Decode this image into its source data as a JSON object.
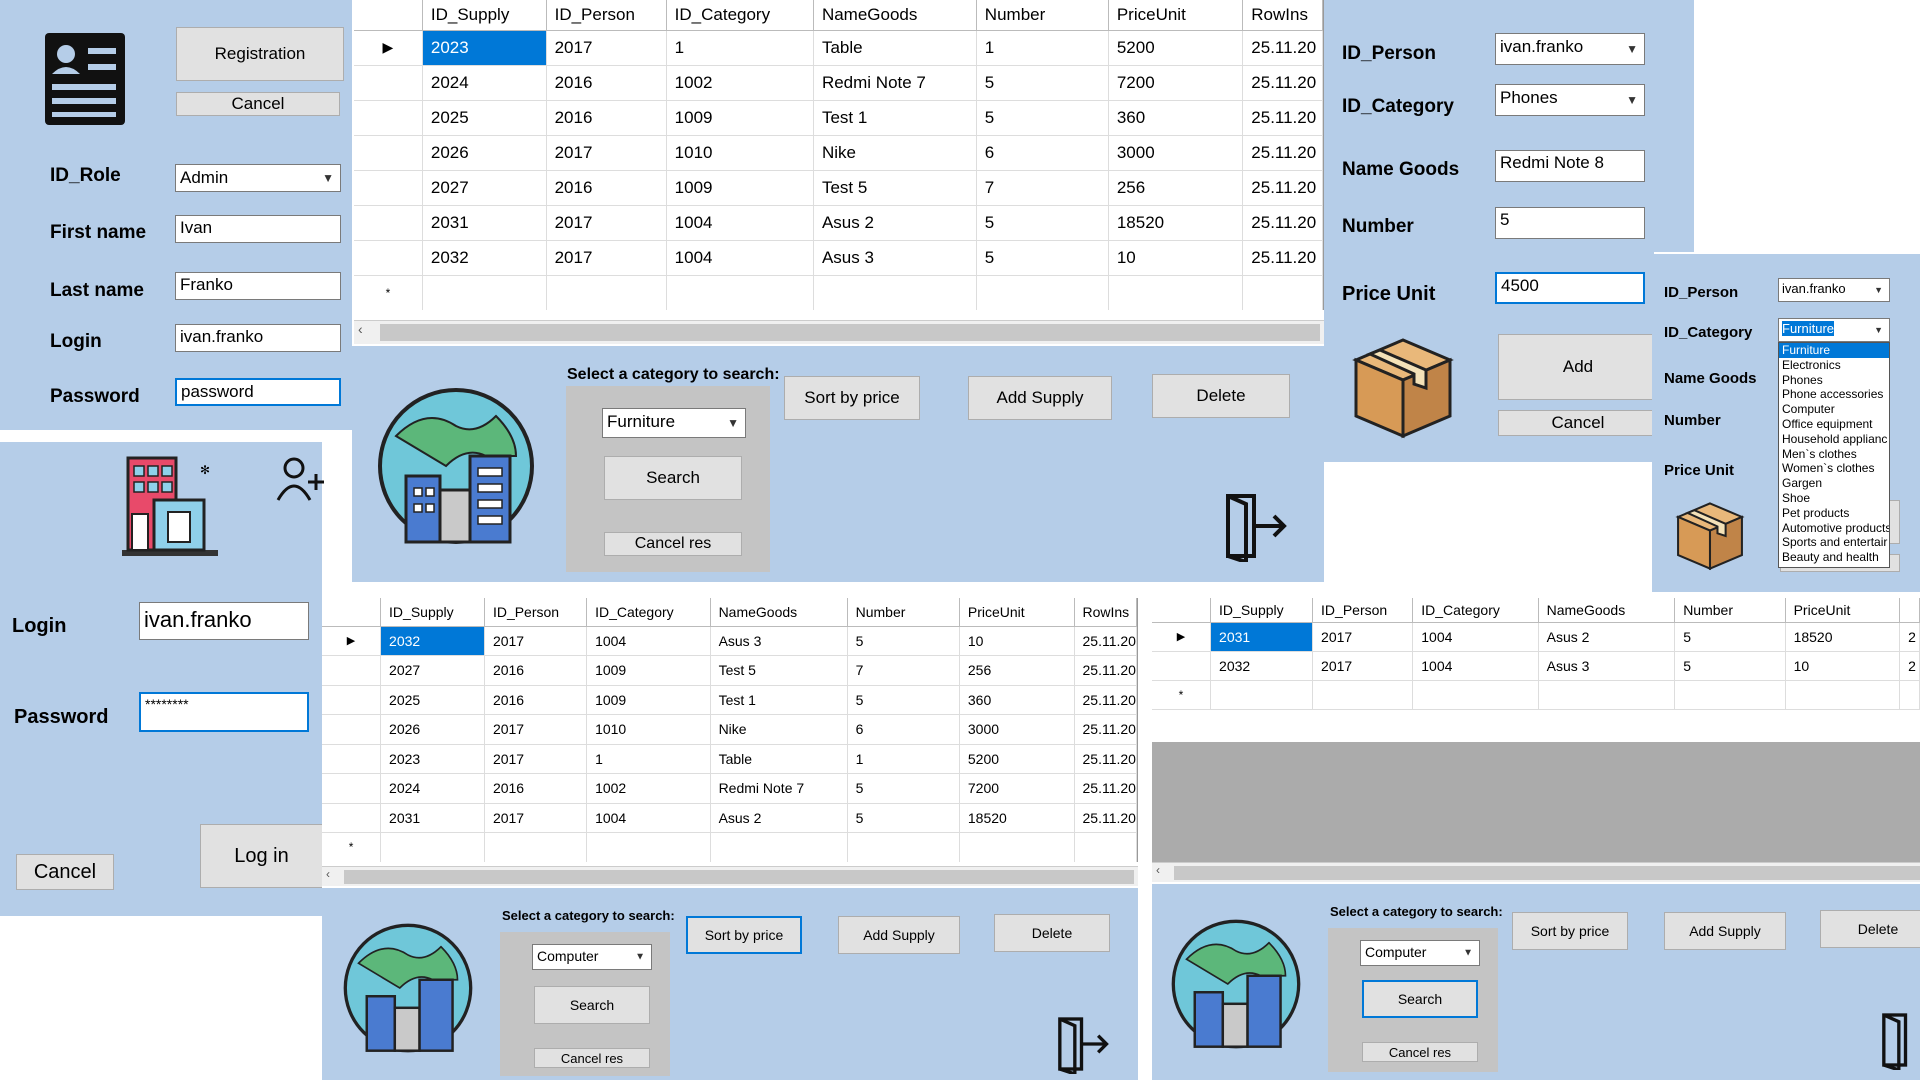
{
  "registration": {
    "btn_registration": "Registration",
    "btn_cancel": "Cancel",
    "lbl_id_role": "ID_Role",
    "val_id_role": "Admin",
    "lbl_first_name": "First name",
    "val_first_name": "Ivan",
    "lbl_last_name": "Last name",
    "val_last_name": "Franko",
    "lbl_login": "Login",
    "val_login": "ivan.franko",
    "lbl_password": "Password",
    "val_password": "password"
  },
  "login": {
    "lbl_login": "Login",
    "val_login": "ivan.franko",
    "lbl_password": "Password",
    "val_password": "********",
    "btn_cancel": "Cancel",
    "btn_login": "Log in"
  },
  "columns": [
    "ID_Supply",
    "ID_Person",
    "ID_Category",
    "NameGoods",
    "Number",
    "PriceUnit",
    "RowIns"
  ],
  "supply_main": {
    "rows": [
      [
        "2023",
        "2017",
        "1",
        "Table",
        "1",
        "5200",
        "25.11.20"
      ],
      [
        "2024",
        "2016",
        "1002",
        "Redmi Note 7",
        "5",
        "7200",
        "25.11.20"
      ],
      [
        "2025",
        "2016",
        "1009",
        "Test 1",
        "5",
        "360",
        "25.11.20"
      ],
      [
        "2026",
        "2017",
        "1010",
        "Nike",
        "6",
        "3000",
        "25.11.20"
      ],
      [
        "2027",
        "2016",
        "1009",
        "Test 5",
        "7",
        "256",
        "25.11.20"
      ],
      [
        "2031",
        "2017",
        "1004",
        "Asus 2",
        "5",
        "18520",
        "25.11.20"
      ],
      [
        "2032",
        "2017",
        "1004",
        "Asus 3",
        "5",
        "10",
        "25.11.20"
      ]
    ],
    "search_label": "Select a category to search:",
    "category": "Furniture",
    "btn_search": "Search",
    "btn_cancel_res": "Cancel res",
    "btn_sort": "Sort by price",
    "btn_add": "Add Supply",
    "btn_delete": "Delete"
  },
  "supply_sorted": {
    "rows": [
      [
        "2032",
        "2017",
        "1004",
        "Asus 3",
        "5",
        "10",
        "25.11.20"
      ],
      [
        "2027",
        "2016",
        "1009",
        "Test 5",
        "7",
        "256",
        "25.11.20"
      ],
      [
        "2025",
        "2016",
        "1009",
        "Test 1",
        "5",
        "360",
        "25.11.20"
      ],
      [
        "2026",
        "2017",
        "1010",
        "Nike",
        "6",
        "3000",
        "25.11.20"
      ],
      [
        "2023",
        "2017",
        "1",
        "Table",
        "1",
        "5200",
        "25.11.20"
      ],
      [
        "2024",
        "2016",
        "1002",
        "Redmi Note 7",
        "5",
        "7200",
        "25.11.20"
      ],
      [
        "2031",
        "2017",
        "1004",
        "Asus 2",
        "5",
        "18520",
        "25.11.20"
      ]
    ],
    "search_label": "Select a category to search:",
    "category": "Computer",
    "btn_search": "Search",
    "btn_cancel_res": "Cancel res",
    "btn_sort": "Sort by price",
    "btn_add": "Add Supply",
    "btn_delete": "Delete"
  },
  "supply_filtered": {
    "rows": [
      [
        "2031",
        "2017",
        "1004",
        "Asus 2",
        "5",
        "18520",
        "2"
      ],
      [
        "2032",
        "2017",
        "1004",
        "Asus 3",
        "5",
        "10",
        "2"
      ]
    ],
    "search_label": "Select a category to search:",
    "category": "Computer",
    "btn_search": "Search",
    "btn_cancel_res": "Cancel res",
    "btn_sort": "Sort by price",
    "btn_add": "Add Supply",
    "btn_delete": "Delete"
  },
  "add_supply": {
    "lbl_id_person": "ID_Person",
    "val_id_person": "ivan.franko",
    "lbl_id_category": "ID_Category",
    "val_id_category": "Phones",
    "lbl_name_goods": "Name Goods",
    "val_name_goods": "Redmi Note 8",
    "lbl_number": "Number",
    "val_number": "5",
    "lbl_price_unit": "Price Unit",
    "val_price_unit": "4500",
    "btn_add": "Add",
    "btn_cancel": "Cancel"
  },
  "add_supply_small": {
    "lbl_id_person": "ID_Person",
    "val_id_person": "ivan.franko",
    "lbl_id_category": "ID_Category",
    "val_id_category": "Furniture",
    "lbl_name_goods": "Name Goods",
    "lbl_number": "Number",
    "lbl_price_unit": "Price Unit",
    "btn_cancel_partial": "Cancel",
    "category_options": [
      "Furniture",
      "Electronics",
      "Phones",
      "Phone accessories",
      "Computer",
      "Office equipment",
      "Household applianc",
      "Men`s clothes",
      "Women`s clothes",
      "Gargen",
      "Shoe",
      "Pet products",
      "Automotive products",
      "Sports and entertair",
      "Beauty and health"
    ]
  },
  "icons": {
    "accent": "#0078d7",
    "panel_bg": "#b5cde8",
    "grid_selection": "#0078d7"
  }
}
